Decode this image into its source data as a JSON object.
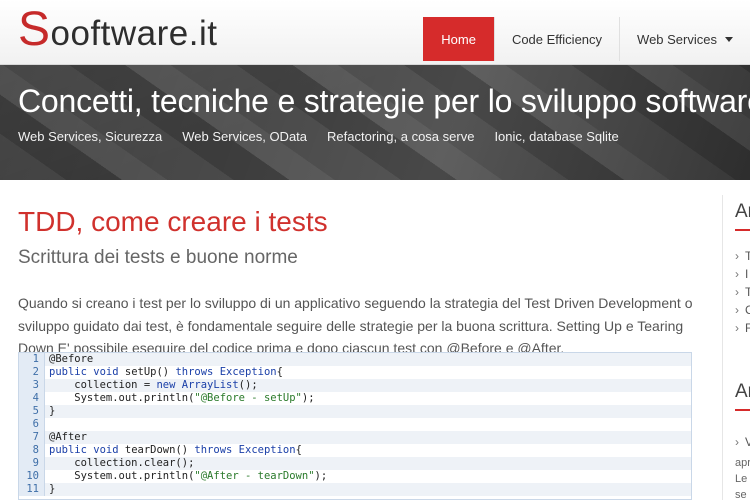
{
  "header": {
    "logo_big": "S",
    "logo_rest": "ooftware.it",
    "nav": [
      {
        "label": "Home",
        "active": true
      },
      {
        "label": "Code Efficiency",
        "active": false
      },
      {
        "label": "Web Services",
        "active": false
      }
    ]
  },
  "hero": {
    "title": "Concetti, tecniche e strategie per lo sviluppo software",
    "links": [
      "Web Services, Sicurezza",
      "Web Services, OData",
      "Refactoring, a cosa serve",
      "Ionic, database Sqlite"
    ]
  },
  "post": {
    "title": "TDD, come creare i tests",
    "subtitle": "Scrittura dei tests e buone norme",
    "body": "Quando si creano i test per lo sviluppo di un applicativo seguendo la strategia del Test Driven Development o sviluppo guidato dai test, è fondamentale seguire delle strategie per la buona scrittura. Setting Up e Tearing Down E' possibile eseguire del codice prima e dopo ciascun test con @Before e @After.",
    "code_lines": [
      "1",
      "2",
      "3",
      "4",
      "5",
      "6",
      "7",
      "8",
      "9",
      "10",
      "11"
    ]
  },
  "sidebar": {
    "title1": "Ar",
    "items1": [
      "T",
      "I",
      "T",
      "C",
      "F"
    ],
    "title2": "Ar",
    "items2": [
      "V"
    ],
    "text": [
      "apr",
      "Le",
      "se"
    ]
  },
  "colors": {
    "accent": "#d62b2b",
    "title_red": "#d0312d"
  }
}
